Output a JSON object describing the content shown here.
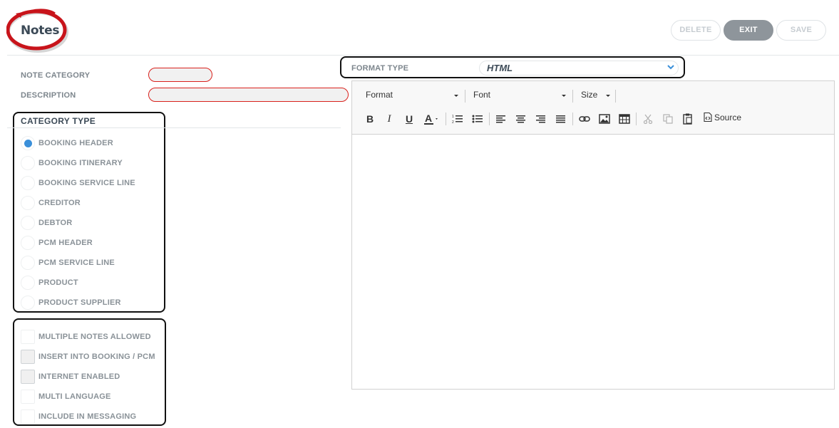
{
  "header": {
    "app_title": "Notes",
    "buttons": {
      "delete": "DELETE",
      "exit": "EXIT",
      "save": "SAVE"
    }
  },
  "form": {
    "note_category_label": "NOTE CATEGORY",
    "description_label": "DESCRIPTION",
    "note_category_value": "",
    "description_value": ""
  },
  "category_type": {
    "title": "CATEGORY TYPE",
    "selected": "BOOKING HEADER",
    "options": [
      "BOOKING HEADER",
      "BOOKING ITINERARY",
      "BOOKING SERVICE LINE",
      "CREDITOR",
      "DEBTOR",
      "PCM HEADER",
      "PCM SERVICE LINE",
      "PRODUCT",
      "PRODUCT SUPPLIER"
    ]
  },
  "flags": [
    "MULTIPLE NOTES ALLOWED",
    "INSERT INTO BOOKING / PCM",
    "INTERNET ENABLED",
    "MULTI LANGUAGE",
    "INCLUDE IN MESSAGING"
  ],
  "format_type": {
    "label": "FORMAT TYPE",
    "value": "HTML"
  },
  "editor": {
    "format_combo": "Format",
    "font_combo": "Font",
    "size_combo": "Size",
    "source_label": "Source",
    "content": ""
  },
  "colors": {
    "accent": "#3a8fd9",
    "required_border": "#d9211c",
    "exit_button": "#8e959b",
    "logo_red": "#c8141b"
  }
}
